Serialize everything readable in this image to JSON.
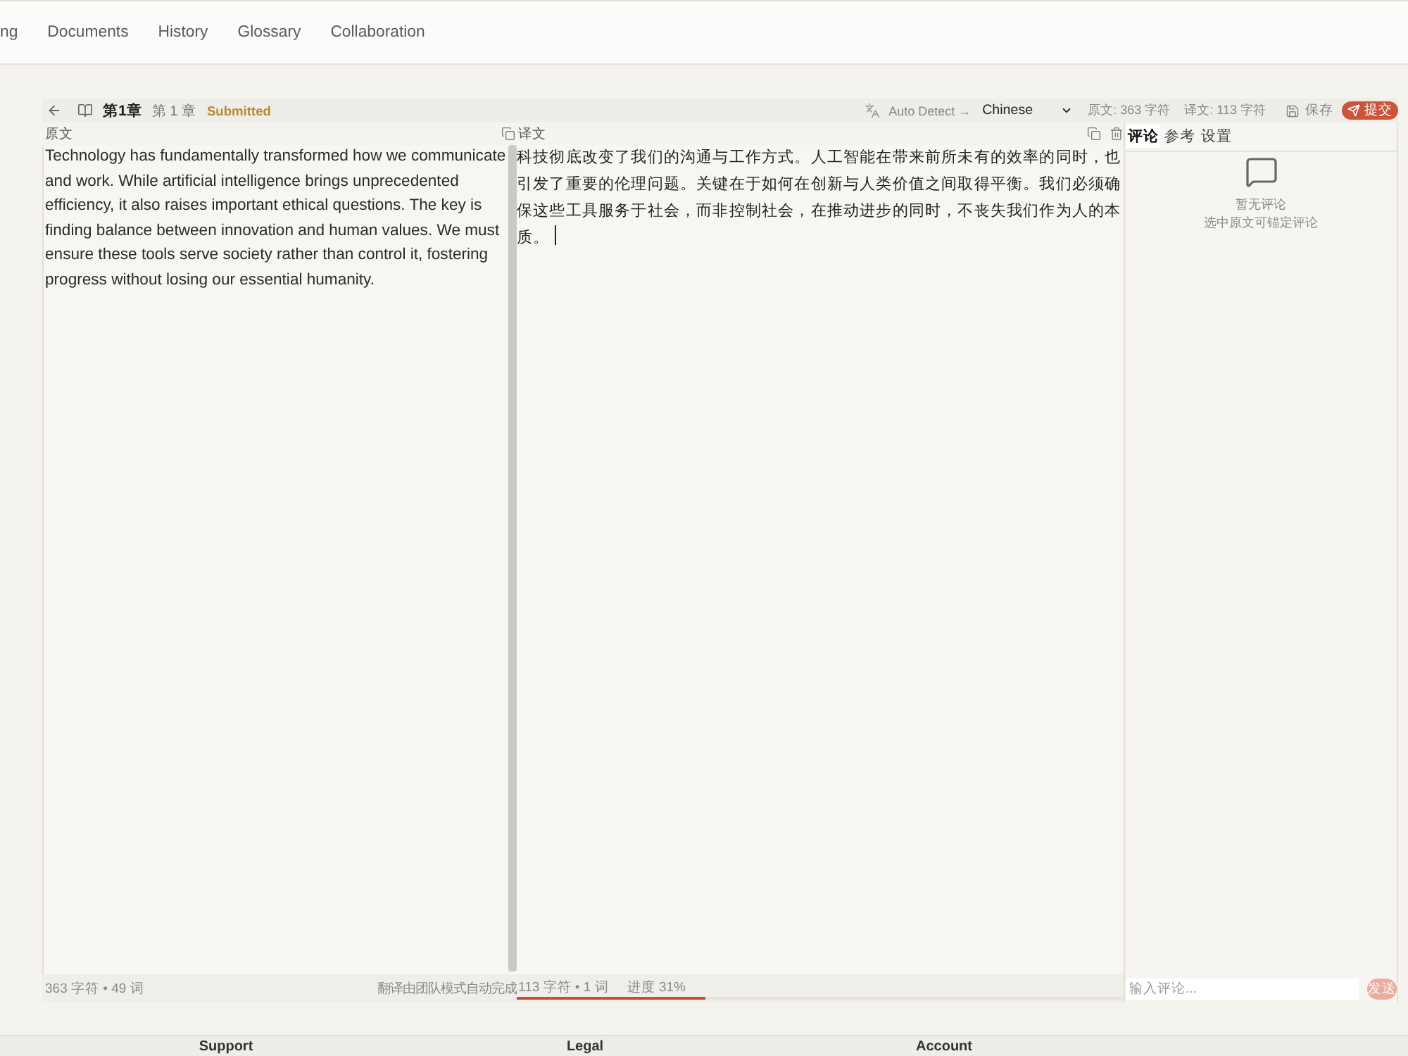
{
  "nav": {
    "items": [
      {
        "label": "ng"
      },
      {
        "label": "Documents"
      },
      {
        "label": "History"
      },
      {
        "label": "Glossary"
      },
      {
        "label": "Collaboration"
      }
    ]
  },
  "toolbar": {
    "chapter": "第1章",
    "chapter_label": "第 1 章",
    "status": "Submitted",
    "source_language": "Auto Detect →",
    "target_language": "Chinese",
    "source_count": "原文: 363 字符",
    "target_count": "译文: 113 字符",
    "save": "保存",
    "submit": "提交"
  },
  "source_panel": {
    "title": "原文",
    "text": "Technology has fundamentally transformed how we communicate and work. While artificial intelligence brings unprecedented efficiency, it also raises important ethical questions. The key is finding balance between innovation and human values. We must ensure these tools serve society rather than control it, fostering progress without losing our essential humanity."
  },
  "translation_panel": {
    "title": "译文",
    "text": "科技彻底改变了我们的沟通与工作方式。人工智能在带来前所未有的效率的同时，也引发了重要的伦理问题。关键在于如何在创新与人类价值之间取得平衡。我们必须确保这些工具服务于社会，而非控制社会，在推动进步的同时，不丧失我们作为人的本质。",
    "focused": true
  },
  "side_panel": {
    "tabs": [
      {
        "label": "评论",
        "selected": true
      },
      {
        "label": "参考",
        "selected": false
      },
      {
        "label": "设置",
        "selected": false
      }
    ],
    "empty_title": "暂无评论",
    "empty_hint": "选中原文可锚定评论",
    "comment_input": {
      "placeholder": "输入评论..."
    },
    "send": {
      "label": "发送",
      "disabled": true
    }
  },
  "source_stats": {
    "counts": "363 字符 • 49 词",
    "note": "翻译由团队模式自动完成"
  },
  "translation_stats": {
    "counts": "113 字符 • 1 词",
    "progress": "进度 31%",
    "progress_bar": {
      "level": 0.31
    }
  },
  "footer": {
    "headings": [
      "Support",
      "Legal",
      "Account"
    ]
  }
}
